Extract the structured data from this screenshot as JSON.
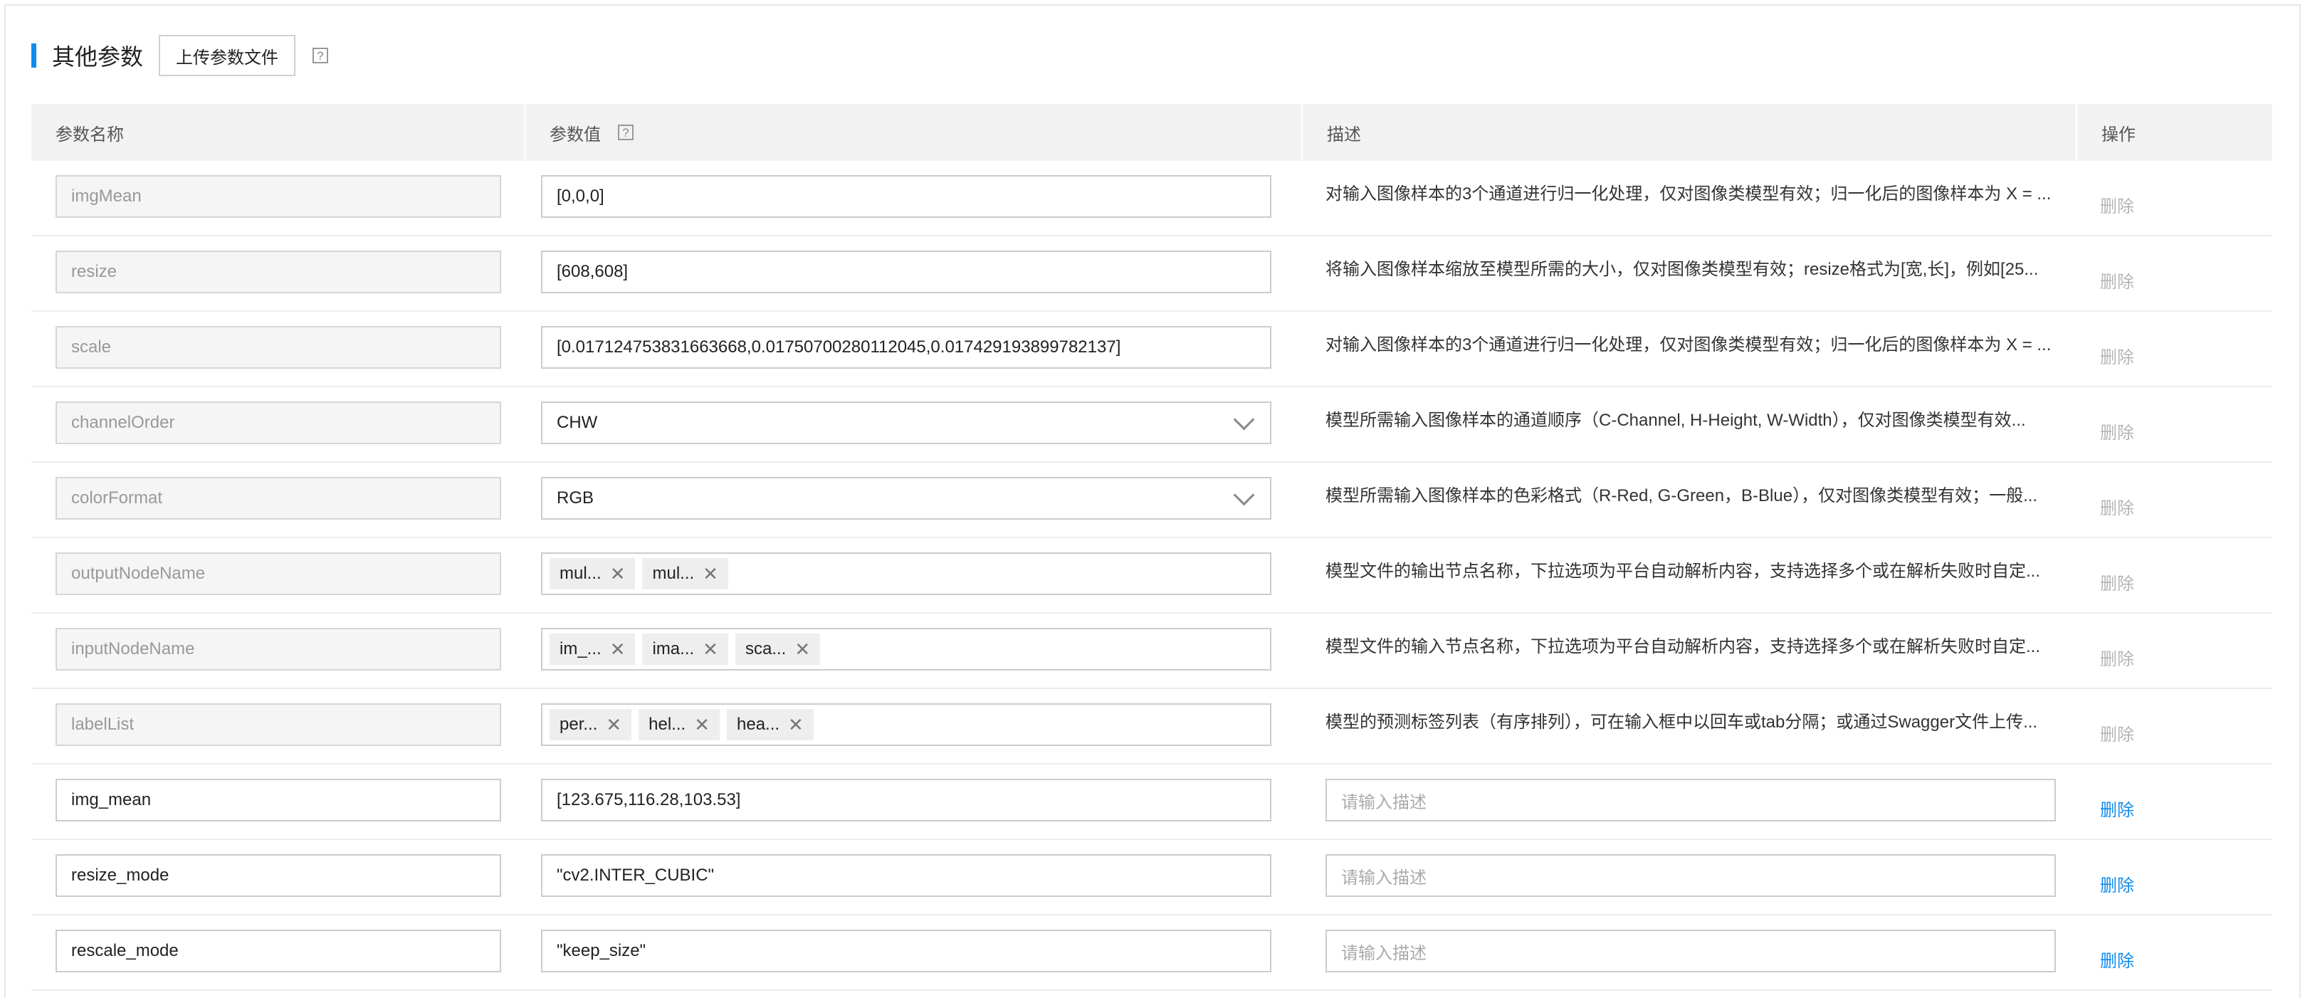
{
  "section": {
    "title": "其他参数",
    "upload_label": "上传参数文件",
    "help": "?"
  },
  "table": {
    "headers": {
      "name": "参数名称",
      "value": "参数值",
      "value_help": "?",
      "desc": "描述",
      "op": "操作"
    },
    "rows": [
      {
        "name": "imgMean",
        "value": "[0,0,0]",
        "desc": "对输入图像样本的3个通道进行归一化处理，仅对图像类模型有效；归一化后的图像样本为 X = ...",
        "op": "删除"
      },
      {
        "name": "resize",
        "value": "[608,608]",
        "desc": "将输入图像样本缩放至模型所需的大小，仅对图像类模型有效；resize格式为[宽,长]，例如[25...",
        "op": "删除"
      },
      {
        "name": "scale",
        "value": "[0.017124753831663668,0.01750700280112045,0.017429193899782137]",
        "desc": "对输入图像样本的3个通道进行归一化处理，仅对图像类模型有效；归一化后的图像样本为 X = ...",
        "op": "删除"
      },
      {
        "name": "channelOrder",
        "value": "CHW",
        "desc": "模型所需输入图像样本的通道顺序（C-Channel, H-Height, W-Width），仅对图像类模型有效...",
        "op": "删除"
      },
      {
        "name": "colorFormat",
        "value": "RGB",
        "desc": "模型所需输入图像样本的色彩格式（R-Red, G-Green，B-Blue），仅对图像类模型有效；一般...",
        "op": "删除"
      },
      {
        "name": "outputNodeName",
        "tags": [
          "mul...",
          "mul..."
        ],
        "desc": "模型文件的输出节点名称，下拉选项为平台自动解析内容，支持选择多个或在解析失败时自定...",
        "op": "删除"
      },
      {
        "name": "inputNodeName",
        "tags": [
          "im_...",
          "ima...",
          "sca..."
        ],
        "desc": "模型文件的输入节点名称，下拉选项为平台自动解析内容，支持选择多个或在解析失败时自定...",
        "op": "删除"
      },
      {
        "name": "labelList",
        "tags": [
          "per...",
          "hel...",
          "hea..."
        ],
        "desc": "模型的预测标签列表（有序排列），可在输入框中以回车或tab分隔；或通过Swagger文件上传...",
        "op": "删除"
      },
      {
        "name": "img_mean",
        "value": "[123.675,116.28,103.53]",
        "desc_placeholder": "请输入描述",
        "op": "删除"
      },
      {
        "name": "resize_mode",
        "value": "\"cv2.INTER_CUBIC\"",
        "desc_placeholder": "请输入描述",
        "op": "删除"
      },
      {
        "name": "rescale_mode",
        "value": "\"keep_size\"",
        "desc_placeholder": "请输入描述",
        "op": "删除"
      }
    ]
  },
  "colors": {
    "accent": "#108cee",
    "disabled_text": "#b5b5b5"
  }
}
